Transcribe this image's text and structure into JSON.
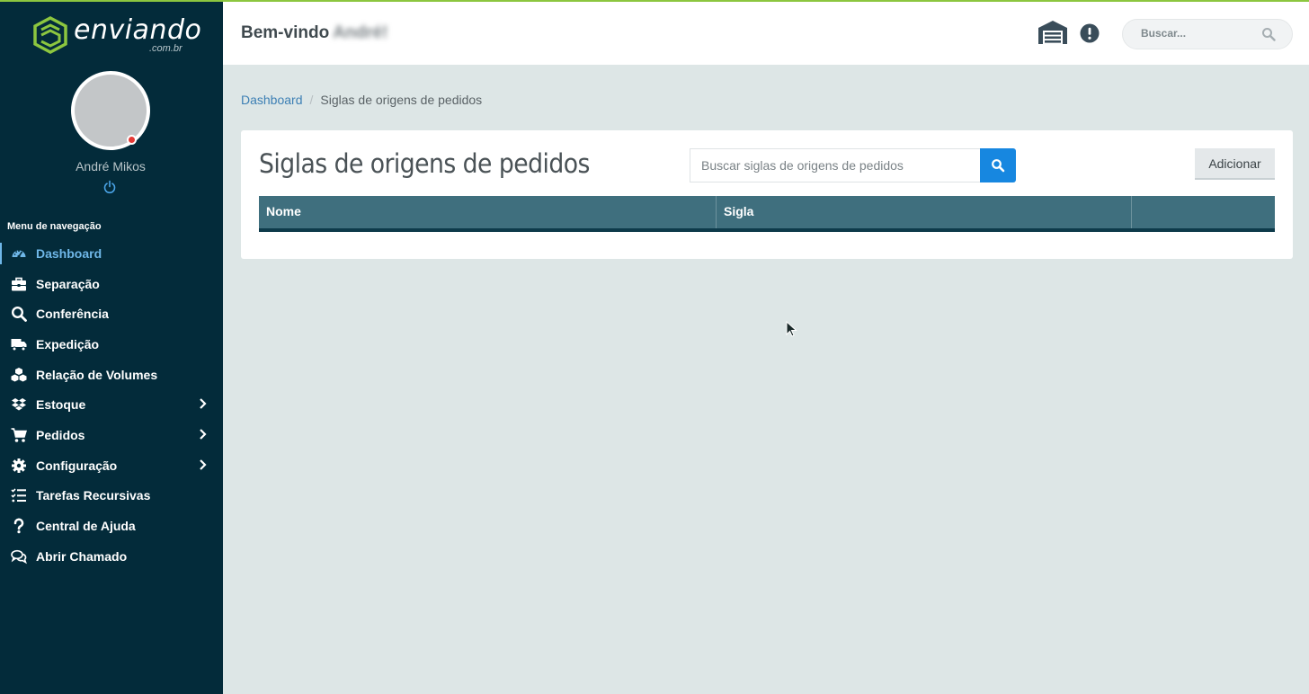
{
  "brand": {
    "name": "enviando",
    "suffix": ".com.br",
    "accent": "#8cc63f"
  },
  "user": {
    "name": "André Mikos",
    "status_color": "#e53935"
  },
  "header": {
    "welcome": "Bem-vindo",
    "welcome_name": "André!",
    "search_placeholder": "Buscar...",
    "icons": [
      "warehouse-icon",
      "alert-icon",
      "search-icon"
    ]
  },
  "sidebar": {
    "heading": "Menu de navegação",
    "items": [
      {
        "label": "Dashboard",
        "icon": "gauge-icon",
        "active": true
      },
      {
        "label": "Separação",
        "icon": "toolbox-icon"
      },
      {
        "label": "Conferência",
        "icon": "search-icon"
      },
      {
        "label": "Expedição",
        "icon": "truck-icon"
      },
      {
        "label": "Relação de Volumes",
        "icon": "cubes-icon"
      },
      {
        "label": "Estoque",
        "icon": "dropbox-icon",
        "submenu": true
      },
      {
        "label": "Pedidos",
        "icon": "cart-icon",
        "submenu": true
      },
      {
        "label": "Configuração",
        "icon": "gear-icon",
        "submenu": true
      },
      {
        "label": "Tarefas Recursivas",
        "icon": "tasks-icon"
      },
      {
        "label": "Central de Ajuda",
        "icon": "question-icon"
      },
      {
        "label": "Abrir Chamado",
        "icon": "chat-icon"
      }
    ]
  },
  "breadcrumb": {
    "home": "Dashboard",
    "current": "Siglas de origens de pedidos"
  },
  "page": {
    "title": "Siglas de origens de pedidos",
    "search_placeholder": "Buscar siglas de origens de pedidos",
    "add_label": "Adicionar",
    "columns": [
      "Nome",
      "Sigla",
      ""
    ],
    "rows": []
  },
  "colors": {
    "sidebar_bg": "#032b3a",
    "active_nav": "#6fb7e8",
    "table_header": "#3f6f7e",
    "primary_button": "#1787e0",
    "page_bg": "#dde6e6"
  }
}
